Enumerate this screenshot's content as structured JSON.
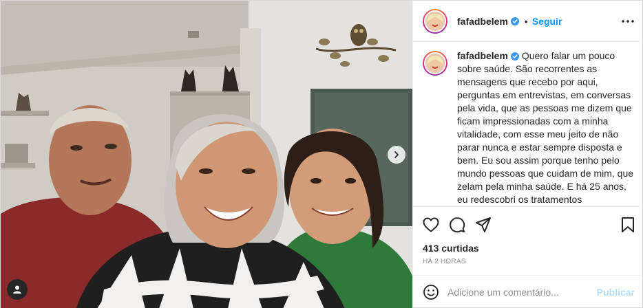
{
  "post": {
    "username": "fafadbelem",
    "separator": "•",
    "follow_label": "Seguir",
    "more_icon": "more-horizontal-icon",
    "caption": "Quero falar um pouco sobre saúde. São recorrentes as mensagens que recebo por aqui, perguntas em entrevistas, em conversas pela vida, que as pessoas me dizem que ficam impressionadas com a minha vitalidade, com esse meu jeito de não parar nunca e estar sempre disposta e bem. Eu sou assim porque tenho pelo mundo pessoas que cuidam de mim, que zelam pela minha saúde. E há 25 anos, eu redescobri os tratamentos",
    "likes": "413 curtidas",
    "time": "HÁ 2 HORAS"
  },
  "comment": {
    "placeholder": "Adicione um comentário...",
    "publish_label": "Publicar"
  },
  "colors": {
    "accent": "#0095f6",
    "publish_disabled": "#b2dffc",
    "verified": "#3897f0"
  },
  "icons": [
    "verified-badge-icon",
    "heart-icon",
    "comment-icon",
    "share-icon",
    "bookmark-icon",
    "emoji-icon",
    "next-arrow-icon",
    "tag-user-icon"
  ]
}
